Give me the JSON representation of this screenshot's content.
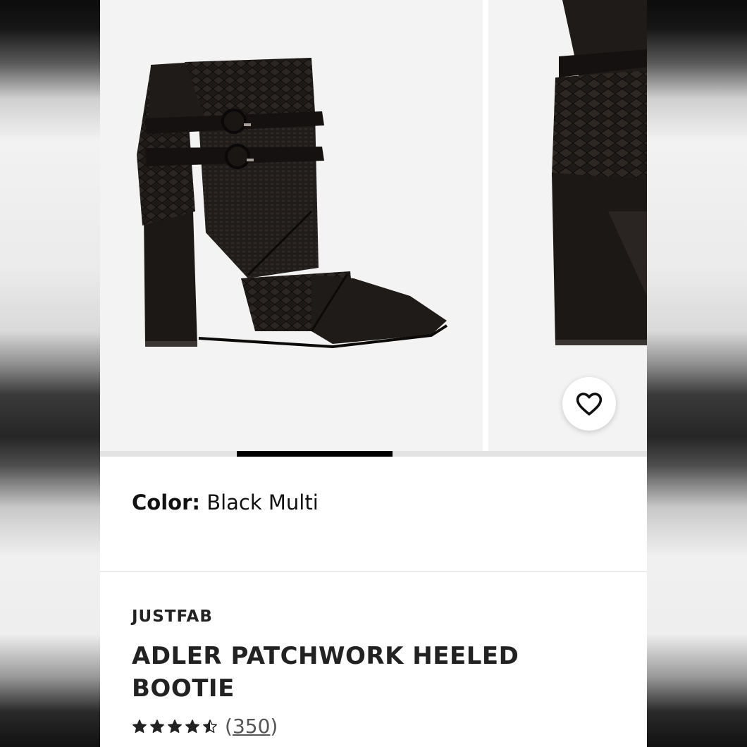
{
  "product": {
    "color_label": "Color:",
    "color_value": "Black Multi",
    "brand": "JUSTFAB",
    "title": "ADLER PATCHWORK HEELED BOOTIE",
    "rating": 4.5,
    "review_count_open": "(",
    "review_count": "350",
    "review_count_close": ")"
  },
  "gallery": {
    "slides": [
      "boot-side-view",
      "boot-back-view"
    ],
    "active_index": 1,
    "position_fraction": 0.25
  },
  "icons": {
    "favorite": "heart-outline-icon",
    "star": "star-icon"
  },
  "colors": {
    "boot": "#1b1715",
    "accent": "#000000",
    "background": "#f3f3f3"
  }
}
